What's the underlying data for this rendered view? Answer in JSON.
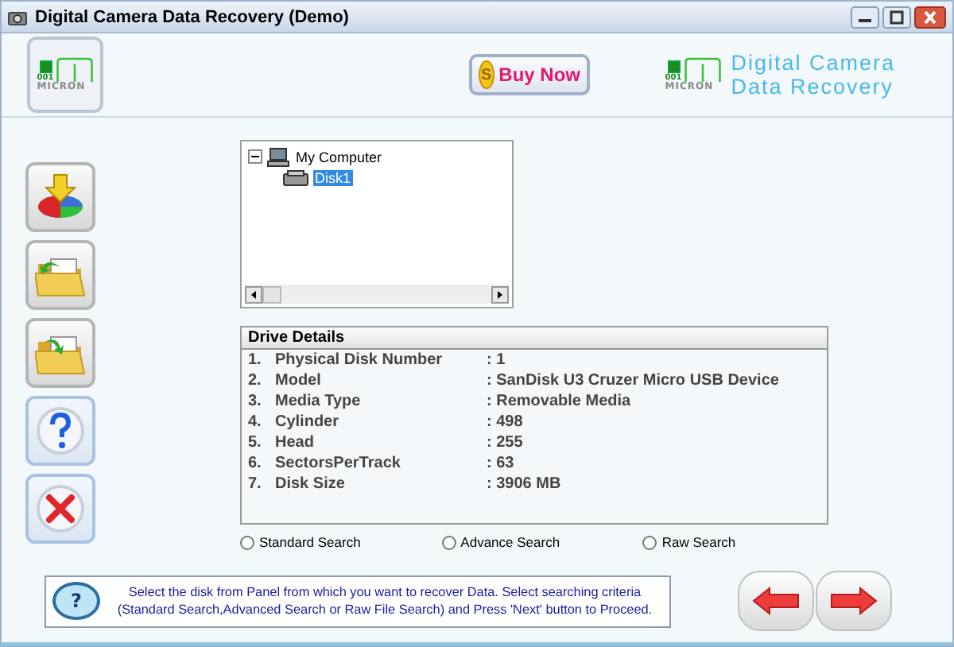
{
  "window": {
    "title": "Digital Camera Data Recovery (Demo)"
  },
  "header": {
    "logo": {
      "digits": "001",
      "brand": "MICRON"
    },
    "buy_button": {
      "label": "Buy Now",
      "coin": "S"
    },
    "product_logo": {
      "digits": "001",
      "brand": "MICRON"
    },
    "product_name": [
      "Digital Camera",
      "Data Recovery"
    ]
  },
  "toolbar": [
    {
      "kind": "disk"
    },
    {
      "kind": "open"
    },
    {
      "kind": "save"
    },
    {
      "kind": "help"
    },
    {
      "kind": "exit"
    }
  ],
  "tree": {
    "items": [
      {
        "label": "My Computer",
        "expanded": true,
        "selected": false,
        "children": [
          {
            "label": "Disk1",
            "selected": true
          }
        ]
      }
    ]
  },
  "drive_details": {
    "title": "Drive Details",
    "rows": [
      {
        "number": "1.",
        "name": "Physical Disk Number",
        "value": ": 1"
      },
      {
        "number": "2.",
        "name": "Model",
        "value": ": SanDisk U3 Cruzer Micro USB Device"
      },
      {
        "number": "3.",
        "name": "Media Type",
        "value": ": Removable Media"
      },
      {
        "number": "4.",
        "name": "Cylinder",
        "value": ": 498"
      },
      {
        "number": "5.",
        "name": "Head",
        "value": ": 255"
      },
      {
        "number": "6.",
        "name": "SectorsPerTrack",
        "value": ": 63"
      },
      {
        "number": "7.",
        "name": "Disk Size",
        "value": ": 3906 MB"
      }
    ]
  },
  "search_options": [
    {
      "label": "Standard Search",
      "selected": false
    },
    {
      "label": "Advance Search",
      "selected": false
    },
    {
      "label": "Raw Search",
      "selected": false
    }
  ],
  "hint": {
    "glyph": "?",
    "text": "Select the disk from Panel from which you want to recover Data. Select searching criteria (Standard Search,Advanced Search or Raw File Search) and Press 'Next' button to Proceed."
  },
  "nav": [
    {
      "kind": "back"
    },
    {
      "kind": "next"
    }
  ]
}
